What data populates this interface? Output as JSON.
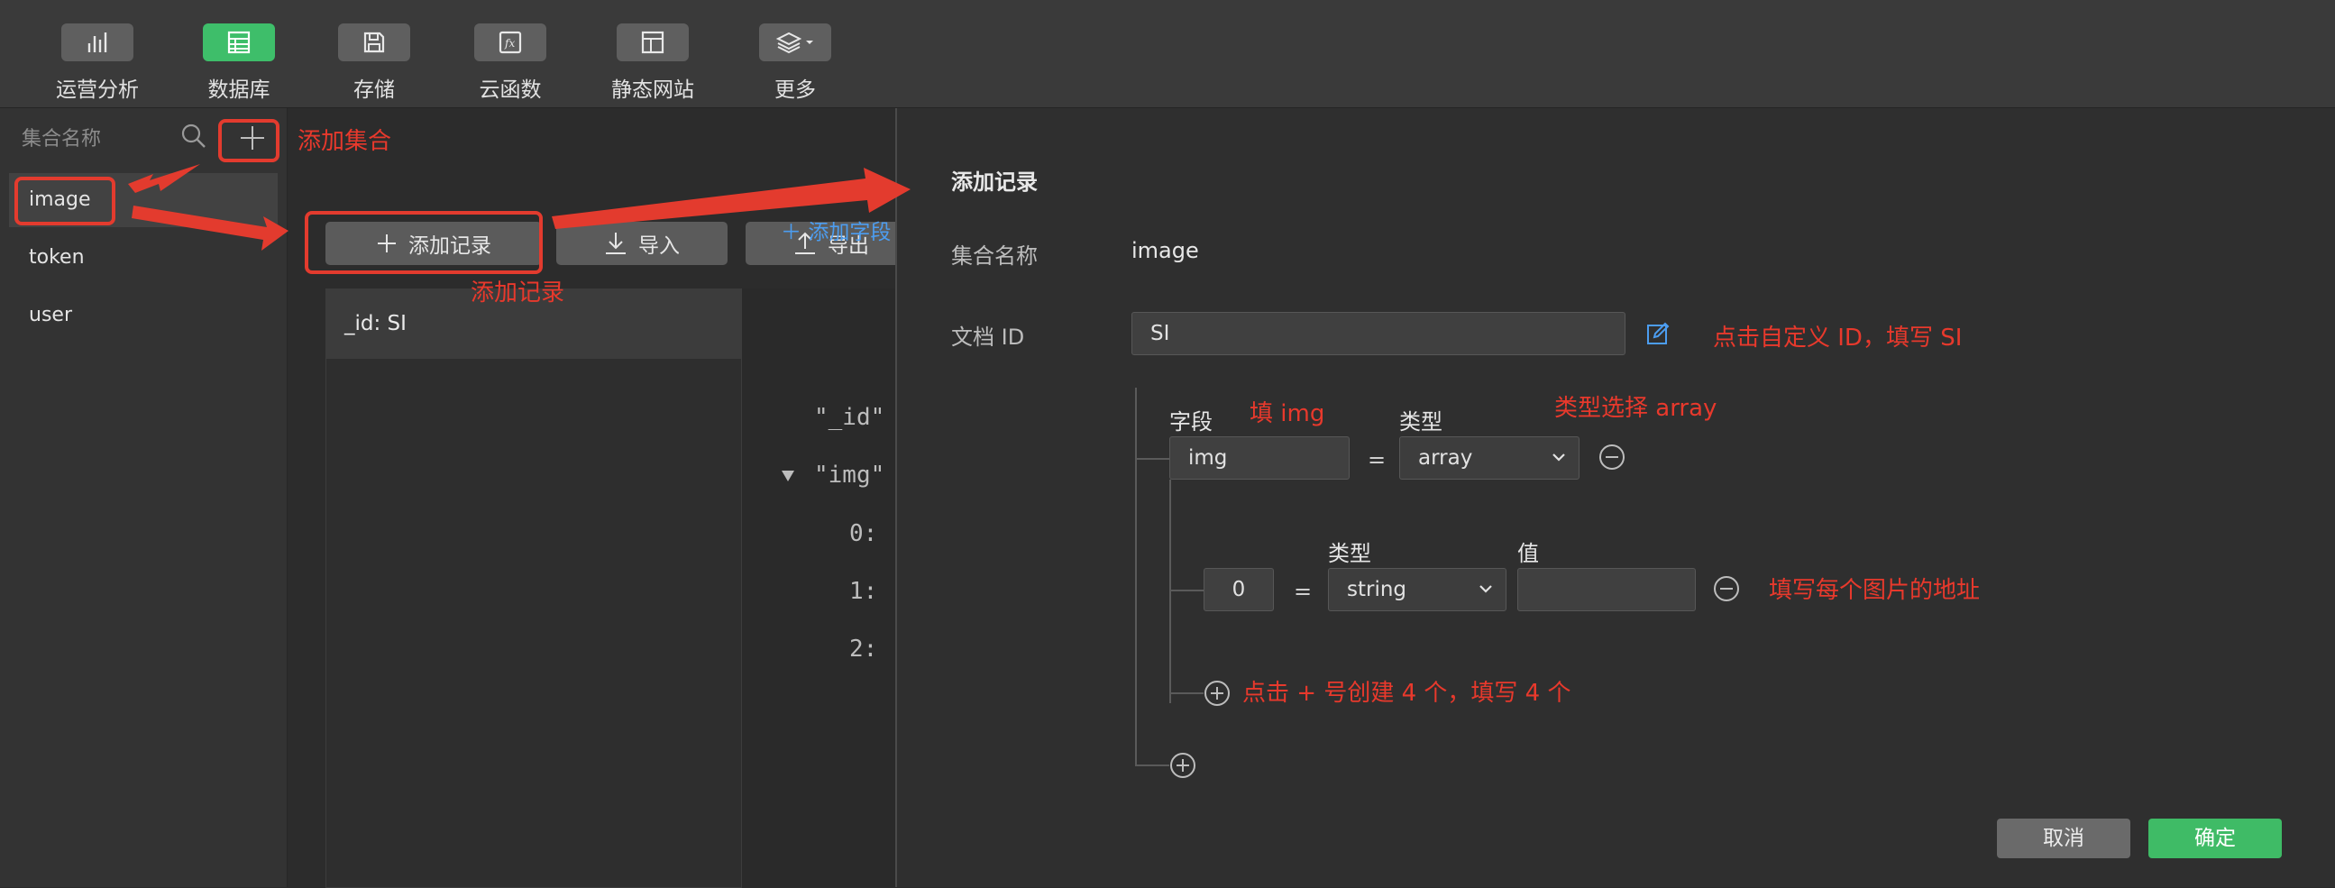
{
  "toolbar": {
    "items": [
      {
        "label": "运营分析",
        "icon": "bar-chart-icon"
      },
      {
        "label": "数据库",
        "icon": "database-icon",
        "active": true
      },
      {
        "label": "存储",
        "icon": "save-icon"
      },
      {
        "label": "云函数",
        "icon": "function-icon"
      },
      {
        "label": "静态网站",
        "icon": "browser-icon"
      },
      {
        "label": "更多",
        "icon": "layers-icon"
      }
    ]
  },
  "sidebar": {
    "search_placeholder": "集合名称",
    "collections": [
      "image",
      "token",
      "user"
    ]
  },
  "middle": {
    "add_record_label": "添加记录",
    "import_label": "导入",
    "export_label": "导出",
    "doc_row": "_id: SI",
    "add_field_label": "添加字段",
    "json_lines": [
      "\"_id\"",
      "\"img\"",
      "0:",
      "1:",
      "2:"
    ]
  },
  "dialog": {
    "title": "添加记录",
    "collection_label": "集合名称",
    "collection_value": "image",
    "doc_id_label": "文档 ID",
    "doc_id_value": "SI",
    "field_header": "字段",
    "type_header": "类型",
    "field_name": "img",
    "eq": "=",
    "field_type": "array",
    "sub_type_header": "类型",
    "sub_value_header": "值",
    "sub_index": "0",
    "sub_type": "string",
    "sub_value": "",
    "cancel_label": "取消",
    "ok_label": "确定"
  },
  "annotations": {
    "add_collection": "添加集合",
    "add_record": "添加记录",
    "custom_id": "点击自定义 ID，填写 SI",
    "fill_img": "填 img",
    "type_array": "类型选择 array",
    "fill_url": "填写每个图片的地址",
    "plus_create": "点击 + 号创建 4 个，填写 4 个"
  },
  "colors": {
    "accent_green": "#3ebe6a",
    "link_blue": "#4c9df0",
    "annotation_red": "#e8392c"
  }
}
